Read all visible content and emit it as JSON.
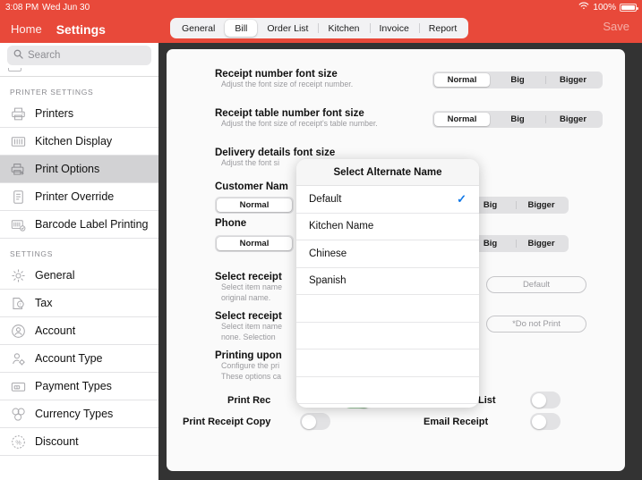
{
  "status_bar": {
    "time": "3:08 PM",
    "date": "Wed Jun 30",
    "battery_pct": "100%",
    "wifi_icon": "wifi-icon",
    "battery_icon": "battery-full-icon"
  },
  "sidebar": {
    "back_label": "Home",
    "title": "Settings",
    "search": {
      "placeholder": "Search",
      "icon": "search-icon",
      "value": ""
    },
    "sections": [
      {
        "header": "PRINTER SETTINGS",
        "items": [
          {
            "label": "Printers",
            "icon": "printer-icon",
            "active": false
          },
          {
            "label": "Kitchen Display",
            "icon": "kitchen-display-icon",
            "active": false
          },
          {
            "label": "Print Options",
            "icon": "print-options-icon",
            "active": true
          },
          {
            "label": "Printer Override",
            "icon": "document-icon",
            "active": false
          },
          {
            "label": "Barcode Label Printing",
            "icon": "barcode-icon",
            "active": false
          }
        ]
      },
      {
        "header": "SETTINGS",
        "items": [
          {
            "label": "General",
            "icon": "gear-icon",
            "active": false
          },
          {
            "label": "Tax",
            "icon": "tax-icon",
            "active": false
          },
          {
            "label": "Account",
            "icon": "account-icon",
            "active": false
          },
          {
            "label": "Account Type",
            "icon": "account-type-icon",
            "active": false
          },
          {
            "label": "Payment Types",
            "icon": "payment-icon",
            "active": false
          },
          {
            "label": "Currency Types",
            "icon": "currency-icon",
            "active": false
          },
          {
            "label": "Discount",
            "icon": "discount-icon",
            "active": false
          }
        ]
      }
    ]
  },
  "topbar": {
    "tabs": [
      {
        "label": "General",
        "selected": false
      },
      {
        "label": "Bill",
        "selected": true
      },
      {
        "label": "Order List",
        "selected": false
      },
      {
        "label": "Kitchen",
        "selected": false
      },
      {
        "label": "Invoice",
        "selected": false
      },
      {
        "label": "Report",
        "selected": false
      }
    ],
    "save_label": "Save"
  },
  "main": {
    "rows": [
      {
        "title": "Receipt number font size",
        "subtitle": "Adjust the font size of receipt number.",
        "options": [
          "Normal",
          "Big",
          "Bigger"
        ],
        "selected": "Normal"
      },
      {
        "title": "Receipt table number font size",
        "subtitle": "Adjust the font size of receipt's table number.",
        "options": [
          "Normal",
          "Big",
          "Bigger"
        ],
        "selected": "Normal"
      },
      {
        "title": "Delivery details font size",
        "subtitle": "Adjust the font si",
        "options": [],
        "selected": ""
      }
    ],
    "customer_name": {
      "title": "Customer Nam",
      "options": [
        "Normal",
        "Big",
        "Bigger"
      ],
      "selected": "Normal"
    },
    "phone": {
      "title": "Phone",
      "options": [
        "Normal",
        "Big",
        "Bigger"
      ],
      "selected": "Normal"
    },
    "select_receipt_1": {
      "title": "Select receipt",
      "subtitle_l1": "Select item name",
      "subtitle_l2": "original name.",
      "button": "Default"
    },
    "select_receipt_2": {
      "title": "Select receipt",
      "subtitle_l1": "Select item name",
      "subtitle_l2": "none. Selection",
      "button": "*Do not Print"
    },
    "printing_upon": {
      "title": "Printing upon",
      "subtitle_l1": "Configure the pri",
      "subtitle_l2": "These options ca"
    },
    "bottom_toggles": [
      {
        "label": "Print Rec",
        "on": false,
        "hidden_behind_modal": true
      },
      {
        "label": "List",
        "on": false
      },
      {
        "label": "Print Receipt Copy",
        "on": false
      },
      {
        "label": "Email Receipt",
        "on": false
      }
    ]
  },
  "modal": {
    "title": "Select Alternate Name",
    "options": [
      {
        "label": "Default",
        "checked": true
      },
      {
        "label": "Kitchen Name",
        "checked": false
      },
      {
        "label": "Chinese",
        "checked": false
      },
      {
        "label": "Spanish",
        "checked": false
      }
    ],
    "check_icon": "checkmark-icon"
  },
  "colors": {
    "accent_red": "#e8493a",
    "check_blue": "#1279e8",
    "toggle_on_green": "#9cc79f"
  }
}
